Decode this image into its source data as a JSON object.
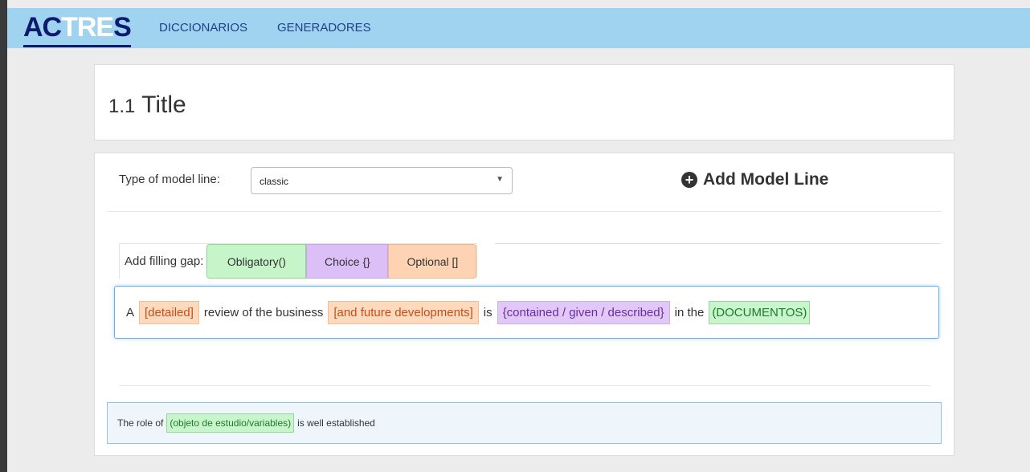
{
  "navbar": {
    "logo_dark_1": "AC",
    "logo_light": "TRE",
    "logo_dark_2": "S",
    "links": [
      "DICCIONARIOS",
      "GENERADORES"
    ]
  },
  "header": {
    "section_number": "1.1",
    "title": "Title"
  },
  "form": {
    "type_label": "Type of model line:",
    "type_value": "classic",
    "add_model_line": "Add Model Line"
  },
  "gap_tabs": {
    "label": "Add filling gap:",
    "obligatory": "Obligatory()",
    "choice": "Choice {}",
    "optional": "Optional []"
  },
  "editor": {
    "t1": "A",
    "opt1": "[detailed]",
    "t2": "review of the business",
    "opt2": "[and future developments]",
    "t3": "is",
    "choice1": "{contained / given / described}",
    "t4": "in the",
    "obl1": "(DOCUMENTOS)"
  },
  "example": {
    "t1": "The role of",
    "obl1": "(objeto de estudio/variables)",
    "t2": "is well established"
  },
  "colors": {
    "navbar": "#9fd3f0",
    "obligatory": "#c6f5c9",
    "choice": "#dcbff6",
    "optional": "#fdd3b3",
    "logo_dark": "#0d1b6e"
  }
}
